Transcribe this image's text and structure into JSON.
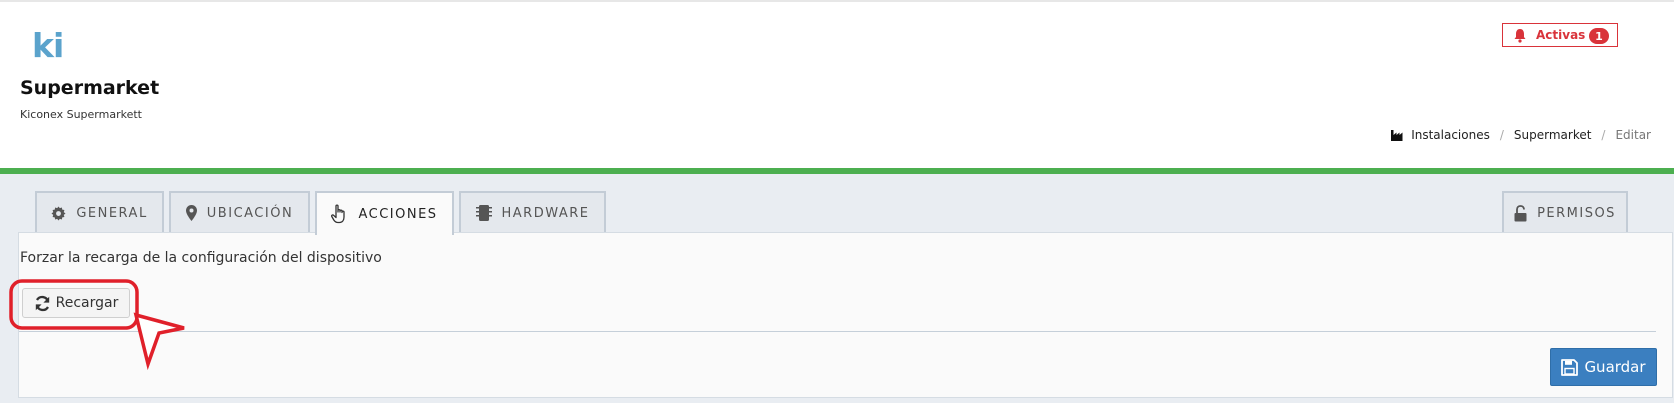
{
  "header": {
    "logo": "ki",
    "title": "Supermarket",
    "subtitle": "Kiconex Supermarkett",
    "alerts": {
      "label": "Activas",
      "count": "1"
    },
    "breadcrumb": [
      {
        "label": "Instalaciones",
        "icon": "factory-icon"
      },
      {
        "label": "Supermarket"
      },
      {
        "label": "Editar",
        "active": true
      }
    ]
  },
  "tabs": [
    {
      "label": "GENERAL",
      "icon": "gear-icon"
    },
    {
      "label": "UBICACIÓN",
      "icon": "map-marker-icon"
    },
    {
      "label": "ACCIONES",
      "icon": "hand-pointer-icon",
      "active": true
    },
    {
      "label": "HARDWARE",
      "icon": "chip-icon"
    },
    {
      "label": "PERMISOS",
      "icon": "unlock-icon"
    }
  ],
  "panel": {
    "description": "Forzar la recarga de la configuración del dispositivo",
    "reload_label": "Recargar",
    "save_label": "Guardar"
  },
  "colors": {
    "accent_green": "#4caf50",
    "alert_red": "#d9333a",
    "primary_blue": "#3b7fc0",
    "annotation_red": "#e0202a"
  }
}
